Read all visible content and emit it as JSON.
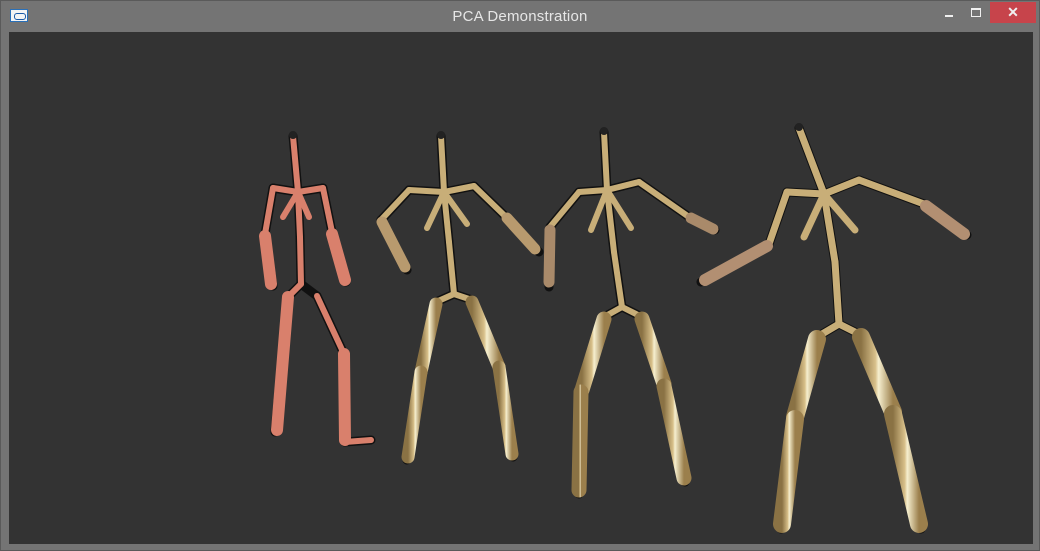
{
  "window": {
    "title": "PCA Demonstration",
    "close_symbol": "✕"
  },
  "icons": {
    "app": "app-window-icon",
    "minimize": "minimize-icon",
    "maximize": "maximize-icon",
    "close": "close-icon"
  },
  "colors": {
    "background": "#333333",
    "figure_1": "#d9806c",
    "figure_2_to_4": "#c8ae78",
    "outline": "#111111"
  }
}
